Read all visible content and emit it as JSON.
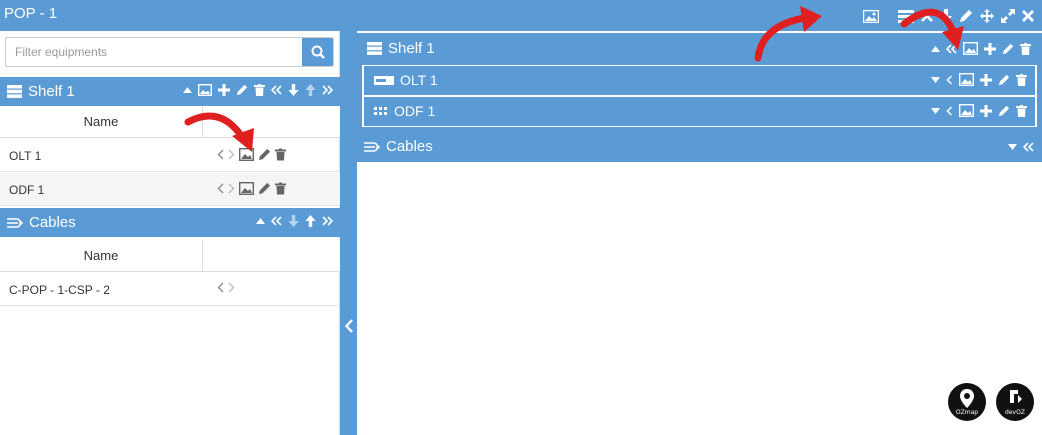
{
  "window": {
    "title": "POP - 1"
  },
  "search": {
    "placeholder": "Filter equipments"
  },
  "left": {
    "shelf": {
      "title": "Shelf 1",
      "column_name": "Name",
      "rows": [
        {
          "label": "OLT 1"
        },
        {
          "label": "ODF 1"
        }
      ]
    },
    "cables": {
      "title": "Cables",
      "column_name": "Name",
      "rows": [
        {
          "label": "C-POP - 1-CSP - 2"
        }
      ]
    }
  },
  "right": {
    "shelf_title": "Shelf 1",
    "items": [
      {
        "label": "OLT 1",
        "icon": "olt-icon"
      },
      {
        "label": "ODF 1",
        "icon": "odf-icon"
      }
    ],
    "cables_title": "Cables"
  },
  "logos": [
    {
      "name": "OZmap",
      "label": "OZmap"
    },
    {
      "name": "devOZ",
      "label": "devOZ"
    }
  ],
  "colors": {
    "accent": "#5b9bd5",
    "annotation_arrow": "#e02020"
  }
}
